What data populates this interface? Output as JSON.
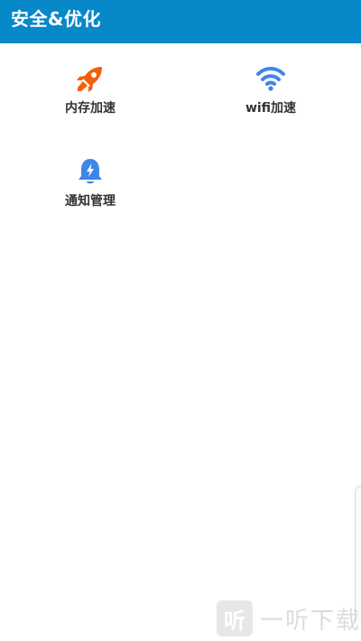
{
  "header": {
    "title": "安全&优化"
  },
  "tiles": [
    {
      "label": "内存加速",
      "icon": "rocket-icon",
      "color": "#f4600a"
    },
    {
      "label": "wifi加速",
      "icon": "wifi-icon",
      "color": "#3f86e6"
    },
    {
      "label": "通知管理",
      "icon": "bell-bolt-icon",
      "color": "#3f86e6"
    }
  ],
  "watermark": {
    "logo_char": "听",
    "text": "一听下载"
  },
  "colors": {
    "header_bg": "#0788c8",
    "accent_orange": "#f4600a",
    "accent_blue": "#3f86e6"
  }
}
